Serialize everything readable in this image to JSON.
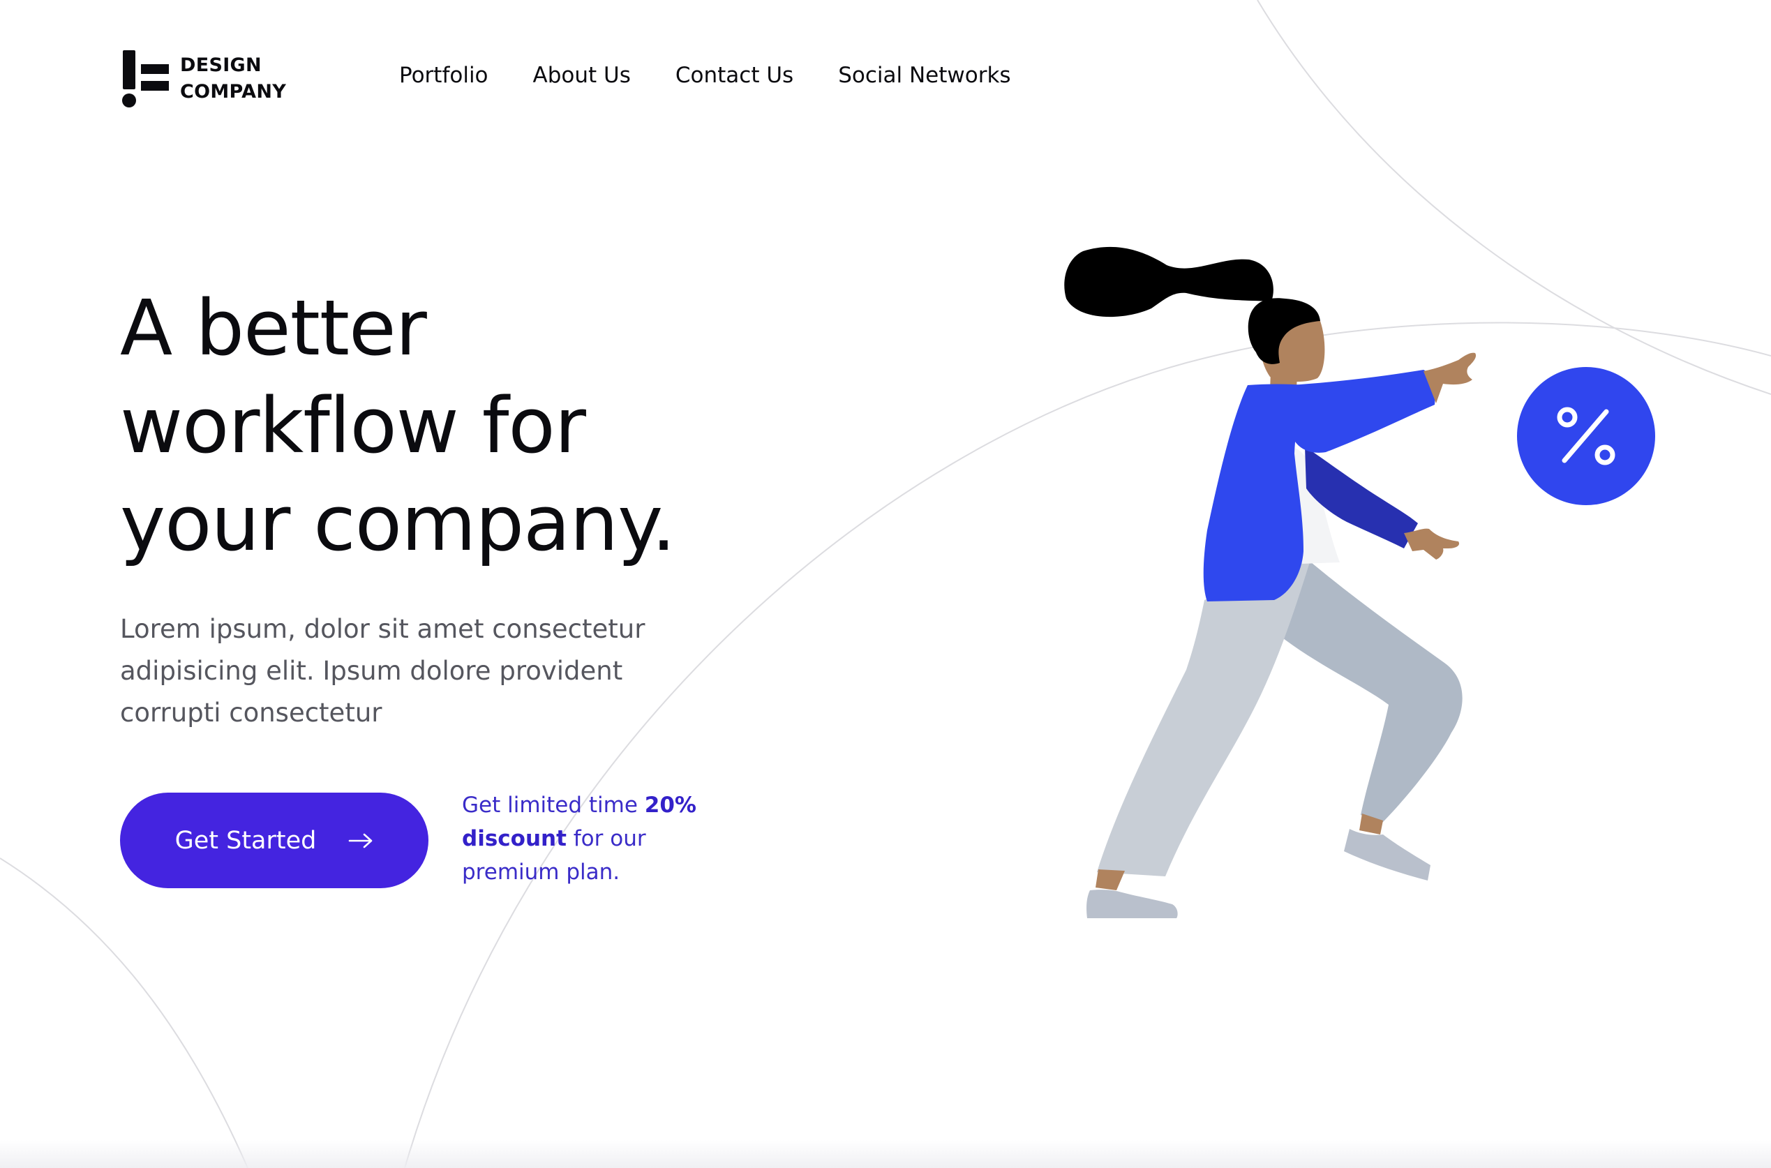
{
  "brand": {
    "line1": "DESIGN",
    "line2": "COMPANY",
    "logo_icon": "exclamation-lines-logo"
  },
  "nav": {
    "items": [
      {
        "label": "Portfolio"
      },
      {
        "label": "About Us"
      },
      {
        "label": "Contact Us"
      },
      {
        "label": "Social Networks"
      }
    ]
  },
  "hero": {
    "headline": [
      "A better",
      "workflow for",
      "your company."
    ],
    "body": [
      "Lorem ipsum, dolor sit amet consectetur",
      "adipisicing elit. Ipsum dolore provident",
      "corrupti consectetur"
    ],
    "cta": {
      "label": "Get Started",
      "icon": "arrow-right-icon"
    },
    "promo": {
      "line1_pre": "Get limited time ",
      "line1_bold": "20%",
      "line2_bold": "discount",
      "line2_post": " for our",
      "line3": "premium plan."
    }
  },
  "illustration": {
    "subject": "woman-reaching-for-discount-badge",
    "badge_icon": "percent-icon",
    "badge_text": "%"
  },
  "colors": {
    "primary": "#4424e0",
    "promo_text": "#3a2cc8",
    "badge": "#3046ee",
    "jacket": "#2f48ee",
    "jacket_shadow": "#2730b0",
    "skin": "#b0835e",
    "hair": "#000000",
    "pants_light": "#c8ced6",
    "pants_dark": "#afb9c6",
    "text_dark": "#0b0b0f",
    "text_muted": "#55565e",
    "arc_lines": "#dcdce0"
  }
}
